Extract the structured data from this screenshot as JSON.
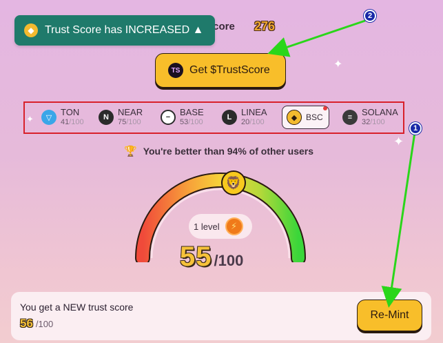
{
  "header": {
    "score_label": "t Score",
    "score_value": "276"
  },
  "toast": {
    "message": "Trust Score has INCREASED ▲",
    "icon": "bnb-coin-icon"
  },
  "get_button": {
    "logo_text": "TS",
    "label": "Get $TrustScore"
  },
  "chains": [
    {
      "name": "TON",
      "score": "41",
      "max": "/100",
      "icon": "ton-icon",
      "color": "#3aa6e8"
    },
    {
      "name": "NEAR",
      "score": "75",
      "max": "/100",
      "icon": "near-icon",
      "color": "#2b2b2b"
    },
    {
      "name": "BASE",
      "score": "53",
      "max": "/100",
      "icon": "base-icon",
      "color": "#ffffff"
    },
    {
      "name": "LINEA",
      "score": "20",
      "max": "/100",
      "icon": "linea-icon",
      "color": "#2b2b2b"
    },
    {
      "name": "BSC",
      "selected": true,
      "icon": "bsc-icon",
      "color": "#f3ba2f"
    },
    {
      "name": "SOLANA",
      "score": "32",
      "max": "/100",
      "icon": "solana-icon",
      "color": "#3a3a3a"
    }
  ],
  "percentile": {
    "text": "You're better than 94% of other users"
  },
  "gauge": {
    "level_label": "1 level",
    "score": "55",
    "max": "/100",
    "value_fraction": 0.55
  },
  "new_score": {
    "title": "You get a NEW trust score",
    "score": "56",
    "max": "/100",
    "button_label": "Re-Mint"
  },
  "annotations": {
    "badge_1": "1",
    "badge_2": "2",
    "arrow_color": "#2ad61a",
    "box_color": "#d8202a"
  },
  "colors": {
    "accent": "#f8be2a",
    "toast_bg": "#1f7a6b"
  }
}
